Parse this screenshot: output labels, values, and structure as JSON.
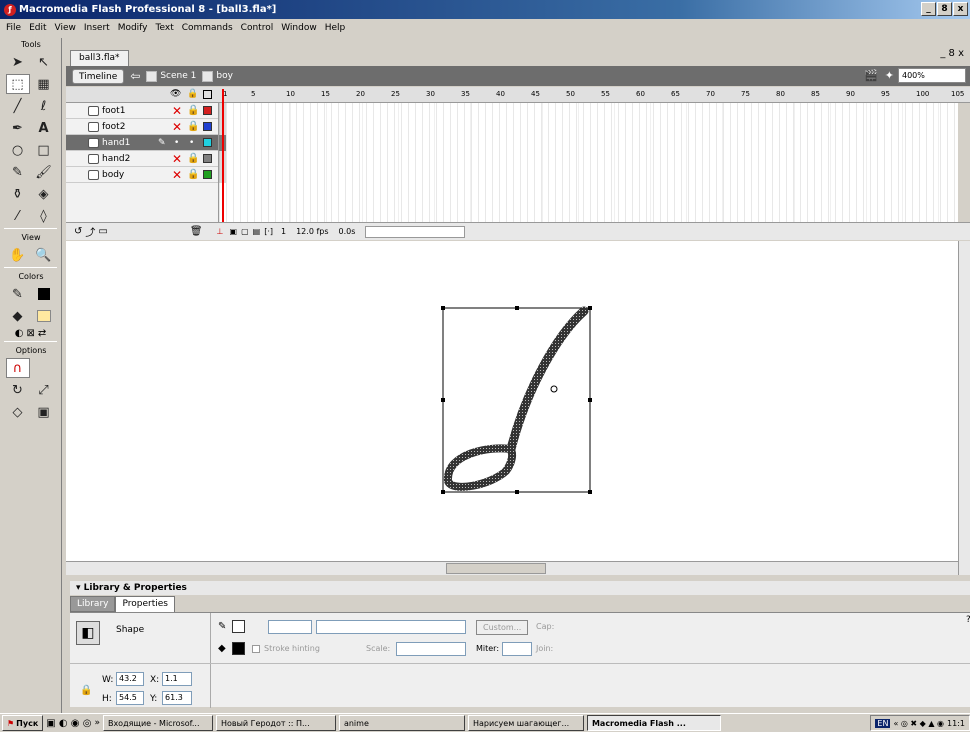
{
  "window": {
    "title": "Macromedia Flash Professional 8 - [ball3.fla*]",
    "min": "_",
    "restore": "8",
    "close": "x"
  },
  "menu": [
    "File",
    "Edit",
    "View",
    "Insert",
    "Modify",
    "Text",
    "Commands",
    "Control",
    "Window",
    "Help"
  ],
  "tools": {
    "title": "Tools",
    "view_label": "View",
    "colors_label": "Colors",
    "options_label": "Options"
  },
  "doc": {
    "tab": "ball3.fla*",
    "controls": "_ 8 x"
  },
  "editbar": {
    "timeline_btn": "Timeline",
    "scene": "Scene 1",
    "symbol": "boy",
    "zoom": "400%"
  },
  "ruler": [
    "1",
    "5",
    "10",
    "15",
    "20",
    "25",
    "30",
    "35",
    "40",
    "45",
    "50",
    "55",
    "60",
    "65",
    "70",
    "75",
    "80",
    "85",
    "90",
    "95",
    "100",
    "105"
  ],
  "layers": [
    {
      "name": "foot1",
      "selected": false,
      "color": "#d42020"
    },
    {
      "name": "foot2",
      "selected": false,
      "color": "#2040d0"
    },
    {
      "name": "hand1",
      "selected": true,
      "color": "#20d0e0"
    },
    {
      "name": "hand2",
      "selected": false,
      "color": "#808080"
    },
    {
      "name": "body",
      "selected": false,
      "color": "#20a020"
    }
  ],
  "tlfoot": {
    "frame": "1",
    "fps": "12.0 fps",
    "time": "0.0s"
  },
  "props": {
    "panel_title": "Library & Properties",
    "tab_library": "Library",
    "tab_properties": "Properties",
    "shape_label": "Shape",
    "stroke_hinting": "Stroke hinting",
    "scale_label": "Scale:",
    "custom_btn": "Custom...",
    "cap_label": "Cap:",
    "miter_label": "Miter:",
    "join_label": "Join:",
    "w_label": "W:",
    "w": "43.2",
    "x_label": "X:",
    "x": "1.1",
    "h_label": "H:",
    "h": "54.5",
    "y_label": "Y:",
    "y": "61.3"
  },
  "taskbar": {
    "start": "Пуск",
    "items": [
      "Входящие - Microsof...",
      "Новый Геродот :: П...",
      "anime",
      "Нарисуем шагающег...",
      "Macromedia Flash ..."
    ],
    "lang": "EN",
    "clock": "11:1"
  }
}
